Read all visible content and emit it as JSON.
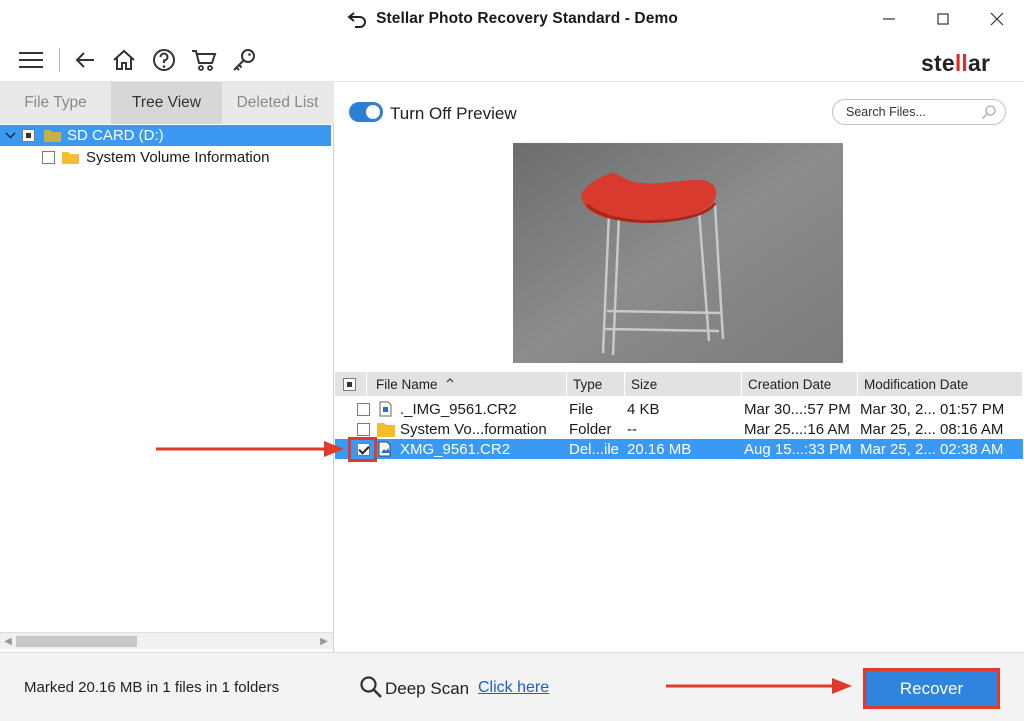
{
  "window": {
    "title": "Stellar Photo Recovery Standard - Demo",
    "title_icon": "restore-icon"
  },
  "toolbar": {
    "icons": [
      "menu-icon",
      "back-icon",
      "home-icon",
      "help-icon",
      "cart-icon",
      "key-icon"
    ],
    "brand_pre": "ste",
    "brand_mid": "ll",
    "brand_post": "ar"
  },
  "left_panel": {
    "tabs": [
      "File Type",
      "Tree View",
      "Deleted List"
    ],
    "active_tab": "Tree View",
    "tree": [
      {
        "label": "SD CARD (D:)",
        "selected": true
      },
      {
        "label": "System Volume Information",
        "selected": false
      }
    ]
  },
  "preview": {
    "toggle_label": "Turn Off Preview",
    "toggle_on": true,
    "search_placeholder": "Search Files..."
  },
  "grid": {
    "columns": [
      "File Name",
      "Type",
      "Size",
      "Creation Date",
      "Modification Date"
    ],
    "rows": [
      {
        "name": "._IMG_9561.CR2",
        "type": "File",
        "size": "4 KB",
        "created": "Mar 30...:57 PM",
        "modified": "Mar 30, 2... 01:57 PM",
        "checked": false,
        "selected": false,
        "icon": "file-icon"
      },
      {
        "name": "System Vo...formation",
        "type": "Folder",
        "size": "--",
        "created": "Mar 25...:16 AM",
        "modified": "Mar 25, 2... 08:16 AM",
        "checked": false,
        "selected": false,
        "icon": "folder-icon"
      },
      {
        "name": "XMG_9561.CR2",
        "type": "Del...ile",
        "size": "20.16 MB",
        "created": "Aug 15...:33 PM",
        "modified": "Mar 25, 2... 02:38 AM",
        "checked": true,
        "selected": true,
        "icon": "image-file-icon"
      }
    ]
  },
  "bottom": {
    "status": "Marked 20.16 MB in 1 files in 1 folders",
    "deep_scan_label": "Deep Scan",
    "deep_scan_link": "Click here",
    "recover_label": "Recover"
  },
  "colors": {
    "accent": "#3a99f3",
    "button": "#2f84de",
    "annotation": "#e03a2a",
    "brand_accent": "#d32f2f"
  }
}
